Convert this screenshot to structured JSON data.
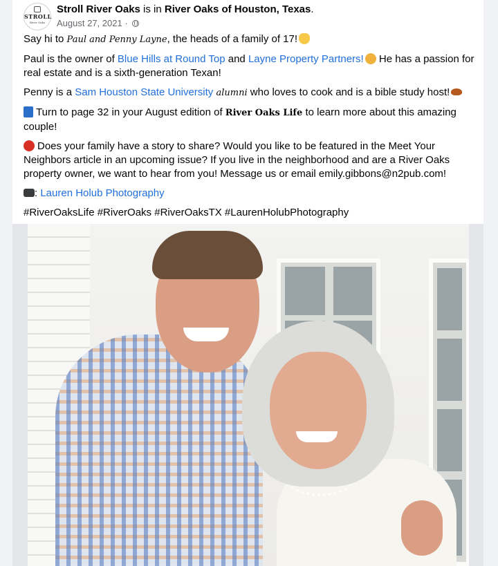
{
  "post": {
    "page_name": "Stroll River Oaks",
    "is_in": " is in ",
    "location": "River Oaks of Houston, Texas",
    "location_suffix": ".",
    "date": "August 27, 2021",
    "date_sep": " · ",
    "avatar_logo_text": "STROLL",
    "avatar_logo_sub": "River Oaks"
  },
  "body": {
    "p1_a": "Say hi to ",
    "p1_names": "Paul and Penny Layne",
    "p1_b": ", the heads of a family of 17!",
    "p2_a": "Paul is the owner of ",
    "p2_link1": "Blue Hills at Round Top",
    "p2_b": " and ",
    "p2_link2": "Layne Property Partners!",
    "p2_c": " He has a passion for real estate and is a sixth-generation Texan!",
    "p3_a": "Penny is a ",
    "p3_link": "Sam Houston State University",
    "p3_b": " ",
    "p3_alumni": "alumni",
    "p3_c": " who loves to cook and is a bible study host!",
    "p4_a": "Turn to page 32 in your August edition of ",
    "p4_mag": "River Oaks Life",
    "p4_b": " to learn more about this amazing couple!",
    "p5": "Does your family have a story to share? Would you like to be featured in the Meet Your Neighbors article in an upcoming issue? If you live in the neighborhood and are a River Oaks property owner, we want to hear from you! Message us or email emily.gibbons@n2pub.com!",
    "p6_a": ": ",
    "p6_link": "Lauren Holub Photography",
    "hashtags": "#RiverOaksLife #RiverOaks #RiverOaksTX #LaurenHolubPhotography"
  },
  "icons": [
    "globe-icon",
    "waving-hand-icon",
    "clapping-hands-icon",
    "pie-icon",
    "blue-book-icon",
    "rose-icon",
    "camera-icon"
  ],
  "colors": {
    "link": "#216fdb",
    "meta": "#65676b",
    "text": "#050505",
    "feed_bg": "#f0f2f5"
  }
}
